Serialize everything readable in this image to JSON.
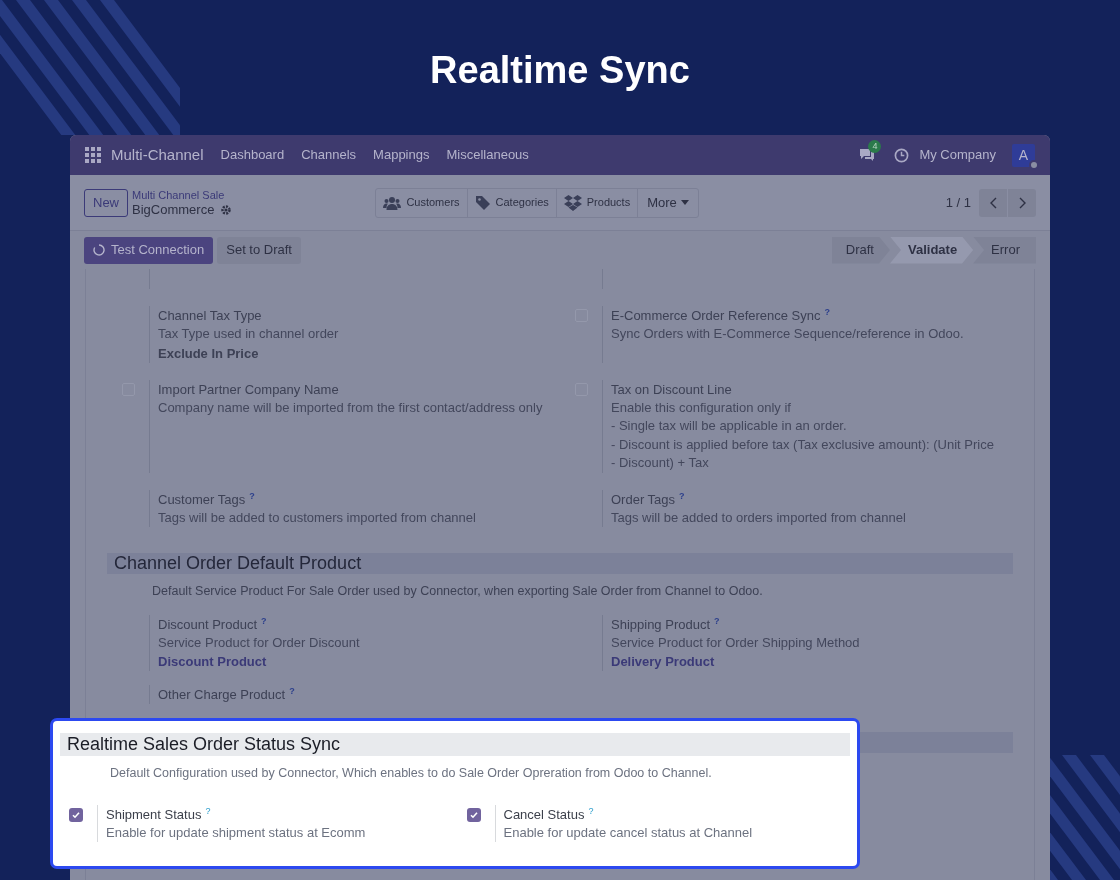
{
  "banner_title": "Realtime Sync",
  "navbar": {
    "app_name": "Multi-Channel",
    "menu": [
      "Dashboard",
      "Channels",
      "Mappings",
      "Miscellaneous"
    ],
    "message_count": "4",
    "company": "My Company",
    "avatar": "A"
  },
  "control_panel": {
    "new_button": "New",
    "breadcrumb_parent": "Multi Channel Sale",
    "record_name": "BigCommerce",
    "smart_buttons": [
      {
        "kind": "users",
        "label": "Customers"
      },
      {
        "kind": "tag",
        "label": "Categories"
      },
      {
        "kind": "box",
        "label": "Products"
      }
    ],
    "more_button": "More",
    "pager": "1 / 1"
  },
  "action_bar": {
    "buttons": [
      {
        "label": "Test Connection",
        "primary": true
      },
      {
        "label": "Set to Draft",
        "primary": false
      }
    ],
    "stages": [
      {
        "label": "Draft",
        "selected": false
      },
      {
        "label": "Validate",
        "selected": true
      },
      {
        "label": "Error",
        "selected": false
      }
    ]
  },
  "settings": [
    {
      "kind": "field",
      "label": "Channel Tax Type",
      "description": [
        "Tax Type used in channel order"
      ],
      "value": "Exclude In Price",
      "link": false
    },
    {
      "kind": "checkbox",
      "checked": false,
      "label": "E-Commerce Order Reference Sync",
      "help": "?",
      "description": [
        "Sync Orders with E-Commerce Sequence/reference in Odoo."
      ]
    },
    {
      "kind": "checkbox",
      "checked": false,
      "label": "Import Partner Company Name",
      "description": [
        "Company name will be imported from the first contact/address only"
      ]
    },
    {
      "kind": "checkbox",
      "checked": false,
      "label": "Tax on Discount Line",
      "description": [
        "Enable this configuration only if",
        "- Single tax will be applicable in an order.",
        "- Discount is applied before tax (Tax exclusive amount): (Unit Price - Discount) + Tax"
      ]
    },
    {
      "kind": "field",
      "label": "Customer Tags",
      "help": "?",
      "description": [
        "Tags will be added to customers imported from channel"
      ]
    },
    {
      "kind": "field",
      "label": "Order Tags",
      "help": "?",
      "description": [
        "Tags will be added to orders imported from channel"
      ]
    }
  ],
  "section": {
    "title": "Channel Order Default Product",
    "description": "Default Service Product For Sale Order used by Connector, when exporting Sale Order from Channel to Odoo.",
    "settings": [
      {
        "kind": "field",
        "label": "Discount Product",
        "help": "?",
        "description": [
          "Service Product for Order Discount"
        ],
        "value": "Discount Product",
        "link": true
      },
      {
        "kind": "field",
        "label": "Shipping Product",
        "help": "?",
        "description": [
          "Service Product for Order Shipping Method"
        ],
        "value": "Delivery Product",
        "link": true
      },
      {
        "kind": "field",
        "label": "Other Charge Product",
        "help": "?"
      }
    ]
  },
  "callout": {
    "title": "Realtime Sales Order Status Sync",
    "description": "Default Configuration used by Connector, Which enables to do Sale Order Opreration from Odoo to Channel.",
    "settings": [
      {
        "kind": "checkbox",
        "checked": true,
        "label": "Shipment Status",
        "help": "?",
        "description": [
          "Enable for update shipment status at Ecomm"
        ]
      },
      {
        "kind": "checkbox",
        "checked": true,
        "label": "Cancel Status",
        "help": "?",
        "description": [
          "Enable for update cancel status at Channel"
        ]
      }
    ]
  }
}
